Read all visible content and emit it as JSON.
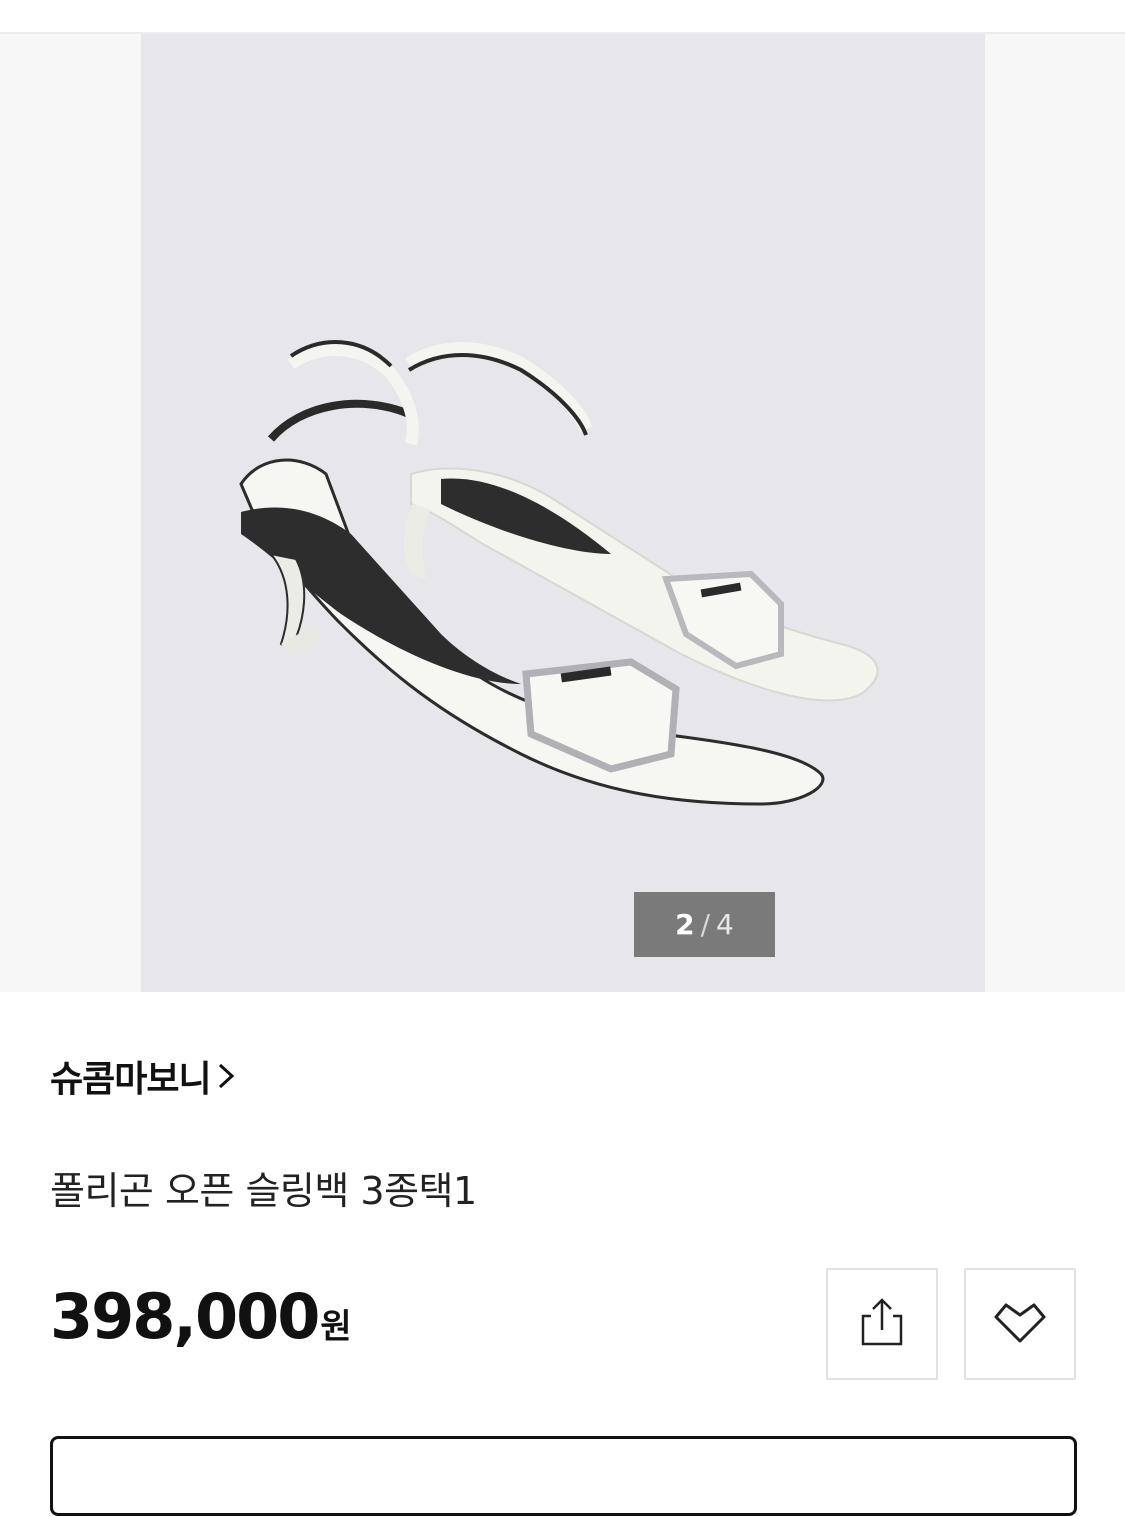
{
  "gallery": {
    "current": "2",
    "separator": "/",
    "total": "4",
    "image_icon": "white-slingback-shoes-image"
  },
  "product": {
    "brand": "슈콤마보니",
    "brand_arrow_icon": "chevron-right-icon",
    "name": "폴리곤 오픈 슬링백 3종택1",
    "price": "398,000",
    "price_unit": "원"
  },
  "actions": {
    "share_icon": "share-icon",
    "wishlist_icon": "heart-icon"
  },
  "colors": {
    "slide_bg": "#e6e6eb",
    "counter_bg": "#6e6e6e",
    "text": "#111111"
  }
}
